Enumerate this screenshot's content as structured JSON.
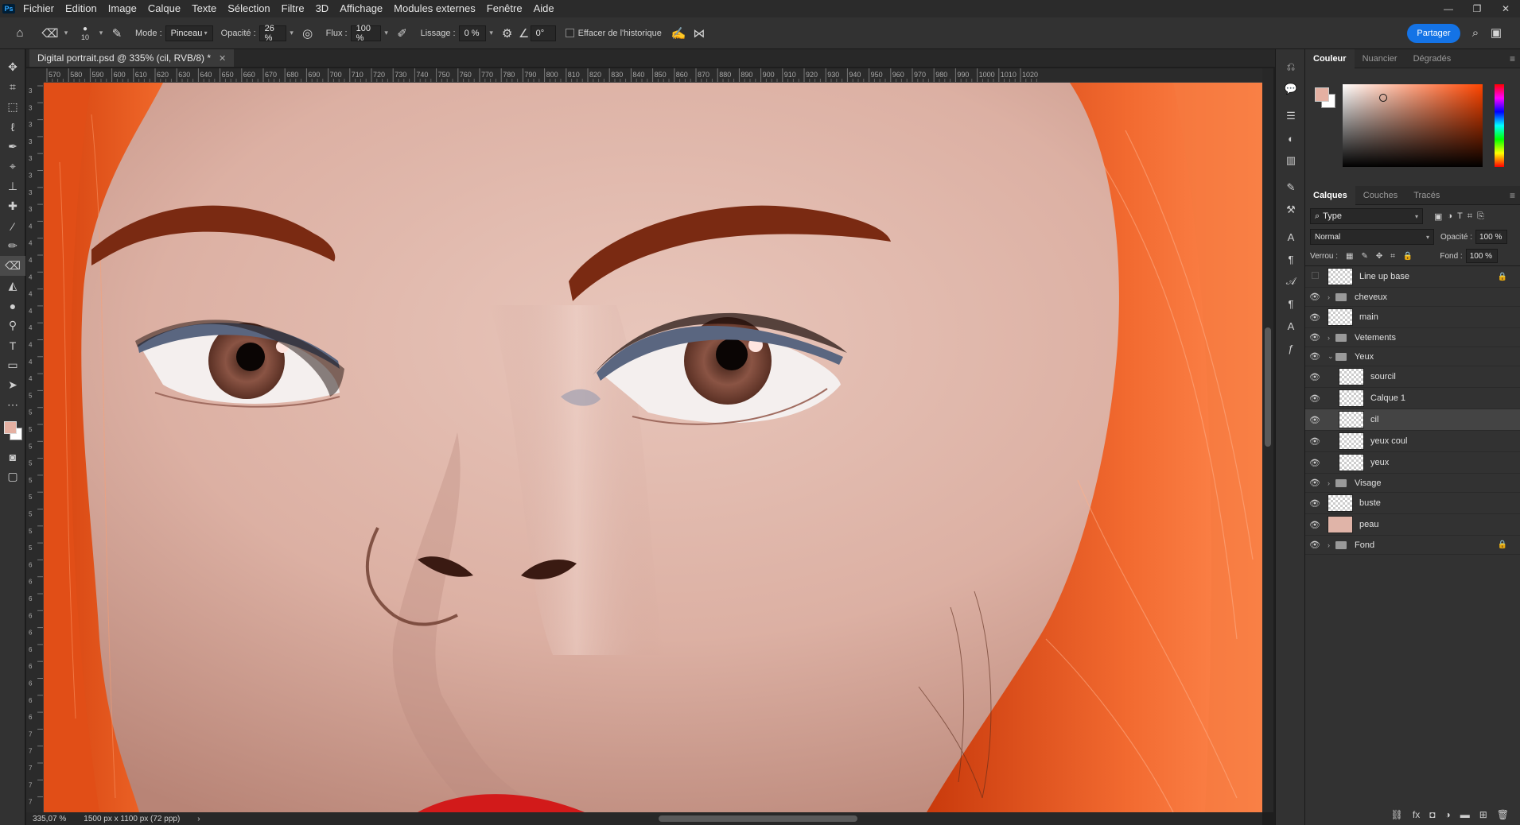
{
  "menu": [
    "Fichier",
    "Edition",
    "Image",
    "Calque",
    "Texte",
    "Sélection",
    "Filtre",
    "3D",
    "Affichage",
    "Modules externes",
    "Fenêtre",
    "Aide"
  ],
  "app_logo": "Ps",
  "options": {
    "brush_size": "10",
    "mode_label": "Mode :",
    "mode_value": "Pinceau",
    "opacity_label": "Opacité :",
    "opacity_value": "26 %",
    "flux_label": "Flux :",
    "flux_value": "100 %",
    "lissage_label": "Lissage :",
    "lissage_value": "0 %",
    "angle_value": "0°",
    "erase_history_label": "Effacer de l'historique",
    "share_label": "Partager"
  },
  "document": {
    "tab_title": "Digital portrait.psd @ 335% (cil, RVB/8) *",
    "zoom": "335,07 %",
    "size_info": "1500 px x 1100 px (72 ppp)"
  },
  "ruler_top": [
    "570",
    "580",
    "590",
    "600",
    "610",
    "620",
    "630",
    "640",
    "650",
    "660",
    "670",
    "680",
    "690",
    "700",
    "710",
    "720",
    "730",
    "740",
    "750",
    "760",
    "770",
    "780",
    "790",
    "800",
    "810",
    "820",
    "830",
    "840",
    "850",
    "860",
    "870",
    "880",
    "890",
    "900",
    "910",
    "920",
    "930",
    "940",
    "950",
    "960",
    "970",
    "980",
    "990",
    "1000",
    "1010",
    "1020"
  ],
  "ruler_left": [
    "3",
    "3",
    "3",
    "3",
    "3",
    "3",
    "3",
    "3",
    "4",
    "4",
    "4",
    "4",
    "4",
    "4",
    "4",
    "4",
    "4",
    "4",
    "5",
    "5",
    "5",
    "5",
    "5",
    "5",
    "5",
    "5",
    "5",
    "5",
    "6",
    "6",
    "6",
    "6",
    "6",
    "6",
    "6",
    "6",
    "6",
    "6",
    "7",
    "7",
    "7",
    "7",
    "7"
  ],
  "color_panel": {
    "tabs": [
      "Couleur",
      "Nuancier",
      "Dégradés"
    ],
    "foreground": "#e4b0a2",
    "background": "#ffffff"
  },
  "layers_panel": {
    "tabs": [
      "Calques",
      "Couches",
      "Tracés"
    ],
    "filter_label": "Type",
    "blend_mode": "Normal",
    "opacity_label": "Opacité :",
    "opacity_value": "100 %",
    "lock_label": "Verrou :",
    "fill_label": "Fond :",
    "fill_value": "100 %",
    "layers": [
      {
        "name": "Line up base",
        "kind": "layer",
        "visible": false,
        "indent": 0,
        "locked": true
      },
      {
        "name": "cheveux",
        "kind": "group",
        "visible": true,
        "indent": 0,
        "expanded": false
      },
      {
        "name": "main",
        "kind": "layer",
        "visible": true,
        "indent": 0
      },
      {
        "name": "Vetements",
        "kind": "group",
        "visible": true,
        "indent": 0,
        "expanded": false
      },
      {
        "name": "Yeux",
        "kind": "group",
        "visible": true,
        "indent": 0,
        "expanded": true
      },
      {
        "name": "sourcil",
        "kind": "layer",
        "visible": true,
        "indent": 1
      },
      {
        "name": "Calque 1",
        "kind": "layer",
        "visible": true,
        "indent": 1
      },
      {
        "name": "cil",
        "kind": "layer",
        "visible": true,
        "indent": 1,
        "selected": true
      },
      {
        "name": "yeux coul",
        "kind": "layer",
        "visible": true,
        "indent": 1
      },
      {
        "name": "yeux",
        "kind": "layer",
        "visible": true,
        "indent": 1
      },
      {
        "name": "Visage",
        "kind": "group",
        "visible": true,
        "indent": 0,
        "expanded": false
      },
      {
        "name": "buste",
        "kind": "layer",
        "visible": true,
        "indent": 0
      },
      {
        "name": "peau",
        "kind": "layer",
        "visible": true,
        "indent": 0,
        "skin": true
      },
      {
        "name": "Fond",
        "kind": "group",
        "visible": true,
        "indent": 0,
        "expanded": false,
        "locked": true
      }
    ]
  }
}
